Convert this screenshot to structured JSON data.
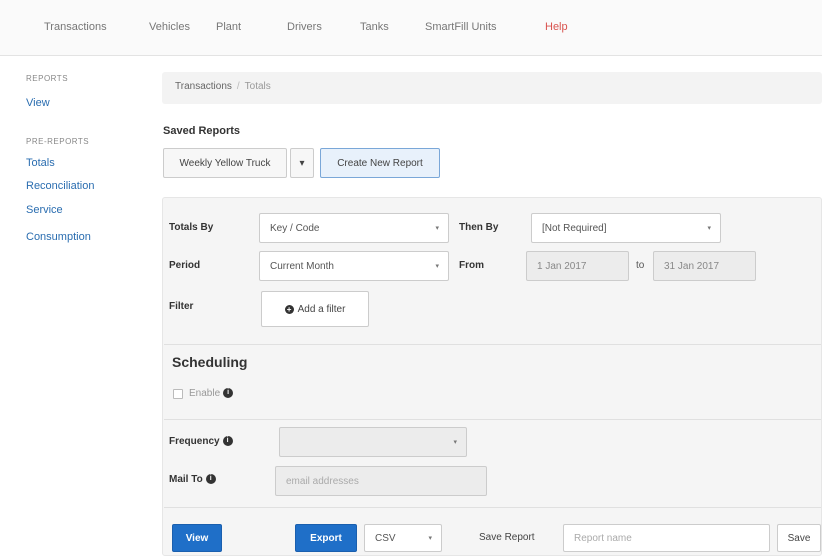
{
  "topnav": {
    "items": [
      "Transactions",
      "Vehicles",
      "Plant",
      "Drivers",
      "Tanks",
      "SmartFill Units"
    ],
    "help": "Help"
  },
  "sidebar": {
    "section1_head": "REPORTS",
    "view": "View",
    "section2_head": "PRE-REPORTS",
    "links": [
      "Totals",
      "Reconciliation",
      "Service",
      "Consumption"
    ]
  },
  "breadcrumb": {
    "parent": "Transactions",
    "separator": "/",
    "current": "Totals"
  },
  "saved_reports": {
    "title": "Saved Reports",
    "selected": "Weekly Yellow Truck",
    "dropdown_caret": "▾",
    "create_button": "Create New Report"
  },
  "form": {
    "totals_by_label": "Totals By",
    "totals_by_value": "Key / Code",
    "then_by_label": "Then By",
    "then_by_value": "[Not Required]",
    "period_label": "Period",
    "period_value": "Current Month",
    "from_label": "From",
    "from_value": "1 Jan 2017",
    "to_label": "to",
    "to_value": "31 Jan 2017",
    "filter_label": "Filter",
    "add_filter_button": "Add a filter",
    "caret": "▾"
  },
  "scheduling": {
    "title": "Scheduling",
    "enable_label": "Enable",
    "frequency_label": "Frequency",
    "frequency_value": "",
    "mail_to_label": "Mail To",
    "mail_to_placeholder": "email addresses"
  },
  "actions": {
    "view_button": "View",
    "export_button": "Export",
    "export_format": "CSV",
    "save_report_label": "Save Report",
    "report_name_placeholder": "Report name",
    "save_button": "Save"
  },
  "icons": {
    "info": "i",
    "plus": "+"
  },
  "colors": {
    "primary": "#1f6fc8",
    "link": "#2a6db0",
    "help": "#d9534f"
  }
}
